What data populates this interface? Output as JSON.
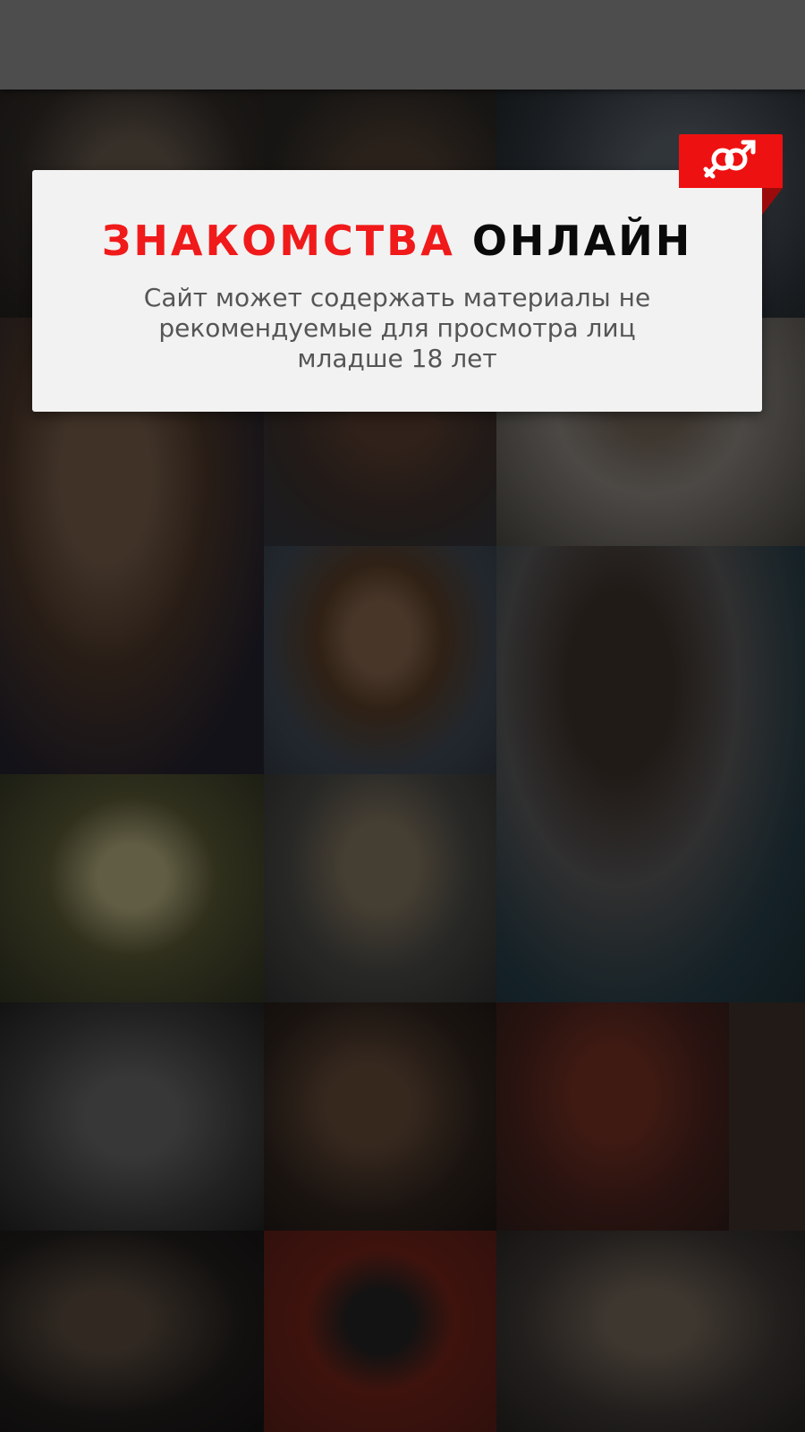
{
  "headline": {
    "red_part": "ЗНАКОМСТВА",
    "dark_part": "ОНЛАЙН"
  },
  "warning_text": "Сайт может содержать материалы не рекомендуемые для просмотра лиц младше 18 лет",
  "badge_icon": "male-female-symbol-icon",
  "colors": {
    "accent": "#ee1111",
    "top_bar": "#4d4d4d",
    "card": "#f2f2f2"
  }
}
